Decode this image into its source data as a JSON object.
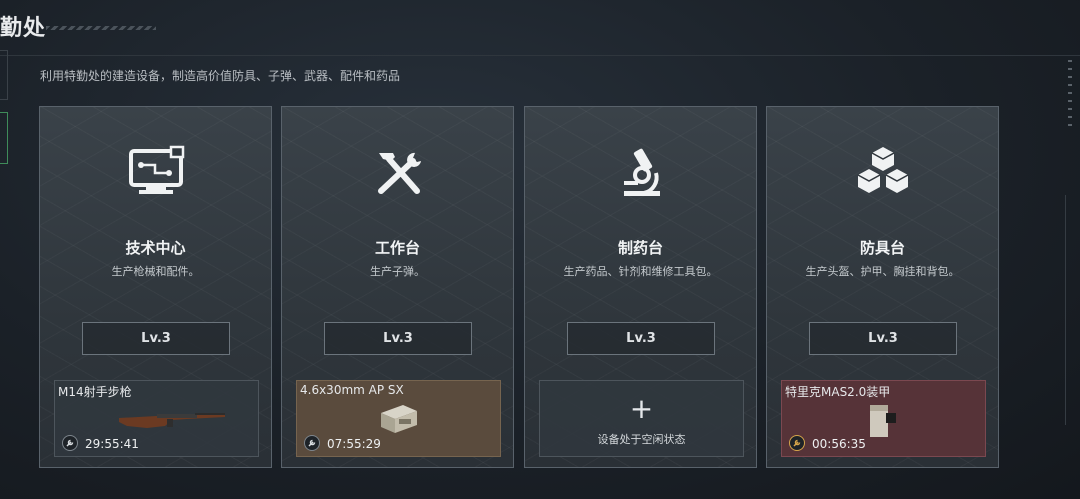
{
  "header": {
    "title": "勤处",
    "subtitle": "利用特勤处的建造设备，制造高价值防具、子弹、武器、配件和药品"
  },
  "cards": [
    {
      "icon": "monitor-icon",
      "title": "技术中心",
      "desc": "生产枪械和配件。",
      "level": "Lv.3",
      "slot": {
        "state": "producing",
        "item": "M14射手步枪",
        "timer": "29:55:41",
        "item_icon": "rifle-icon"
      }
    },
    {
      "icon": "hammer-wrench-icon",
      "title": "工作台",
      "desc": "生产子弹。",
      "level": "Lv.3",
      "slot": {
        "state": "producing",
        "item": "4.6x30mm AP SX",
        "timer": "07:55:29",
        "item_icon": "ammo-box-icon",
        "bg": "#5a4b3d"
      }
    },
    {
      "icon": "microscope-icon",
      "title": "制药台",
      "desc": "生产药品、针剂和维修工具包。",
      "level": "Lv.3",
      "slot": {
        "state": "idle",
        "plus": "+",
        "idle_text": "设备处于空闲状态"
      }
    },
    {
      "icon": "cubes-icon",
      "title": "防具台",
      "desc": "生产头盔、护甲、胸挂和背包。",
      "level": "Lv.3",
      "slot": {
        "state": "producing",
        "item": "特里克MAS2.0装甲",
        "timer": "00:56:35",
        "item_icon": "armor-icon",
        "bg": "#563338"
      }
    }
  ],
  "colors": {
    "card_border": "#59626b",
    "timer_gold": "#d4a44a",
    "active_green": "#3f8c5a"
  }
}
